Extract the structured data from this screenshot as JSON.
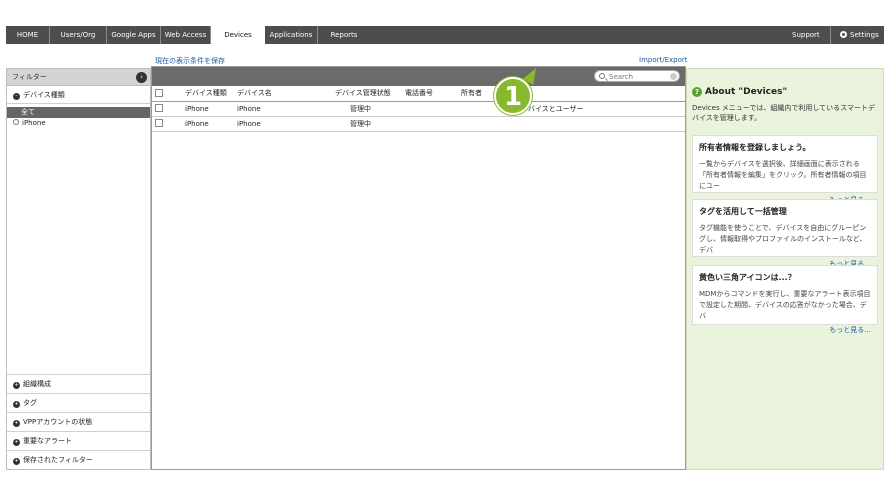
{
  "nav": {
    "tabs": [
      {
        "label": "HOME"
      },
      {
        "label": "Users/Org"
      },
      {
        "label": "Google Apps"
      },
      {
        "label": "Web Access"
      },
      {
        "label": "Devices"
      },
      {
        "label": "Applications"
      },
      {
        "label": "Reports"
      }
    ],
    "active_tab": "Devices",
    "support_label": "Support",
    "settings_label": "Settings"
  },
  "toolbar": {
    "save_filter_link": "現在の表示条件を保存",
    "import_export_link": "Import/Export"
  },
  "filter": {
    "title": "フィルター",
    "device_type_section": "デバイス種類",
    "items": [
      "全て",
      "iPhone"
    ],
    "bottom_sections": [
      "組織構成",
      "タグ",
      "VPPアカウントの状態",
      "重要なアラート",
      "保存されたフィルター"
    ]
  },
  "search": {
    "placeholder": "Search"
  },
  "table": {
    "headers": [
      "デバイス種類",
      "デバイス名",
      "デバイス管理状態",
      "電話番号",
      "所有者",
      "デバイスとユーザー"
    ],
    "rows": [
      {
        "type": "iPhone",
        "name": "iPhone",
        "status": "管理中",
        "phone": "",
        "owner": ""
      },
      {
        "type": "iPhone",
        "name": "iPhone",
        "status": "管理中",
        "phone": "",
        "owner": ""
      }
    ]
  },
  "callout": {
    "number": "1",
    "color": "#88b82e"
  },
  "help": {
    "title": "About \"Devices\"",
    "intro": "Devices メニューでは、組織内で利用しているスマートデバイスを管理します。",
    "cards": [
      {
        "title": "所有者情報を登録しましょう。",
        "text": "一覧からデバイスを選択後、詳細画面に表示される「所有者情報を編集」をクリック。所有者情報の項目にユー",
        "more": "もっと見る..."
      },
      {
        "title": "タグを活用して一括管理",
        "text": "タグ機能を使うことで、デバイスを自由にグルーピングし、情報取得やプロファイルのインストールなど、デバ",
        "more": "もっと見る..."
      },
      {
        "title": "黄色い三角アイコンは...？",
        "text": "MDMからコマンドを実行し、重要なアラート表示項目で設定した期間、デバイスの応答がなかった場合、デバ",
        "more": "もっと見る..."
      }
    ]
  },
  "colors": {
    "nav_bg": "#4d4d4d",
    "help_bg": "#eaf3dc",
    "link": "#1f5aa6"
  }
}
